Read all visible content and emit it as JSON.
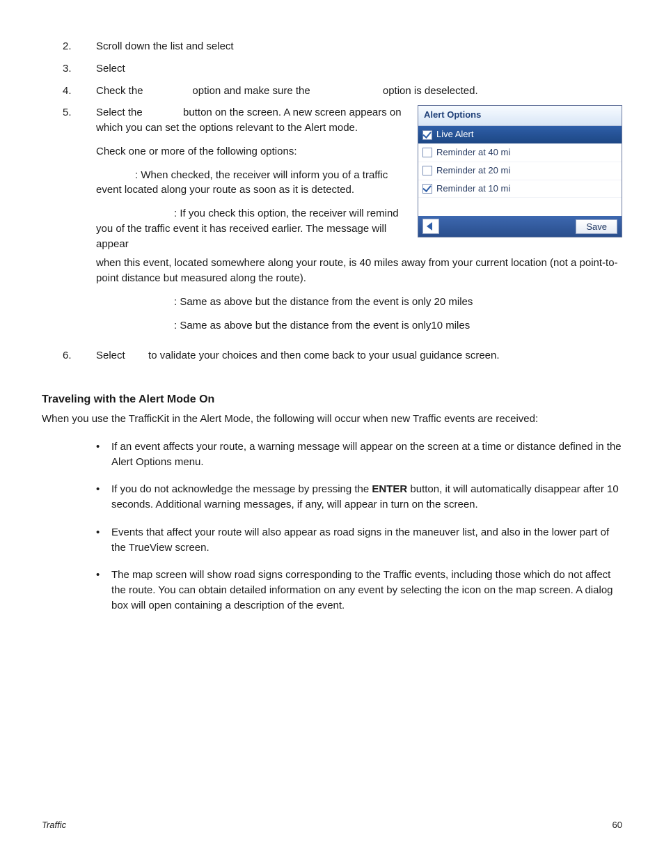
{
  "steps": {
    "s2": {
      "num": "2.",
      "text": "Scroll down the list and select"
    },
    "s3": {
      "num": "3.",
      "text": "Select"
    },
    "s4": {
      "num": "4.",
      "seg1": "Check the",
      "seg2": "option and make sure the",
      "seg3": "option is deselected."
    },
    "s5": {
      "num": "5.",
      "p1": "Select the              button on the screen. A new screen appears on which you can set the options relevant to the Alert mode.",
      "p2": "Check one or more of the following options:",
      "p3": ": When checked, the receiver will inform you of a traffic event located along your route as soon as it is detected.",
      "p4a": ": If you check this option, the receiver will remind you of the traffic event it has received earlier. The message will appear",
      "p4b": "when this event, located somewhere along your route, is 40 miles away from your current location (not a point-to-point distance but measured along the route).",
      "p5": ": Same as above but the distance from the event is only 20 miles",
      "p6": ": Same as above but the distance from the event is only10 miles"
    },
    "s6": {
      "num": "6.",
      "seg1": "Select",
      "seg2": "to validate your choices and then come back to your usual guidance screen."
    }
  },
  "alert_widget": {
    "title": "Alert Options",
    "rows": [
      {
        "label": "Live Alert",
        "checked": true,
        "selected": true
      },
      {
        "label": "Reminder at 40 mi",
        "checked": false,
        "selected": false
      },
      {
        "label": "Reminder at 20 mi",
        "checked": false,
        "selected": false
      },
      {
        "label": "Reminder at 10 mi",
        "checked": true,
        "selected": false
      }
    ],
    "save": "Save"
  },
  "section": {
    "heading": "Traveling with the Alert Mode On",
    "intro": "When you use the TrafficKit in the Alert Mode, the following will occur when new Traffic events are received:",
    "bullets": [
      "If an event affects your route, a warning message will appear on the screen at a time or distance defined in the Alert Options menu.",
      {
        "pre": "If you do not acknowledge the message by pressing the ",
        "bold": "ENTER",
        "post": " button, it will automatically disappear after 10 seconds. Additional warning messages, if any, will appear in turn on the screen."
      },
      "Events that affect your route will also appear as road signs in the maneuver list, and also in the lower part of the TrueView screen.",
      "The map screen will show road signs corresponding to the Traffic events, including those which do not affect the route. You can obtain detailed information on any event by selecting the icon on the map screen. A dialog box will open containing a description of the event."
    ]
  },
  "footer": {
    "section": "Traffic",
    "page": "60"
  }
}
